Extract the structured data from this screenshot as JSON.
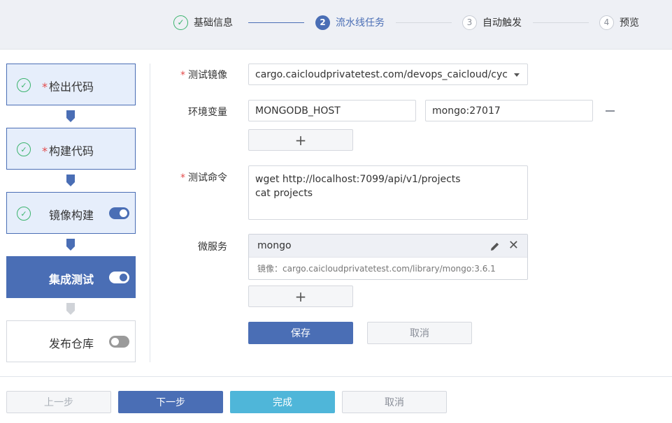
{
  "stepper": {
    "steps": [
      {
        "num": "✓",
        "label": "基础信息",
        "state": "done"
      },
      {
        "num": "2",
        "label": "流水线任务",
        "state": "active"
      },
      {
        "num": "3",
        "label": "自动触发",
        "state": "pending"
      },
      {
        "num": "4",
        "label": "预览",
        "state": "pending"
      }
    ]
  },
  "pipeline": {
    "stages": [
      {
        "label": "检出代码",
        "required": "*",
        "completed": true,
        "toggle": null
      },
      {
        "label": "构建代码",
        "required": "*",
        "completed": true,
        "toggle": null
      },
      {
        "label": "镜像构建",
        "required": "",
        "completed": true,
        "toggle": "on"
      },
      {
        "label": "集成测试",
        "required": "",
        "completed": false,
        "toggle": "on",
        "active": true
      },
      {
        "label": "发布仓库",
        "required": "",
        "completed": false,
        "toggle": "off"
      }
    ]
  },
  "form": {
    "test_image": {
      "label": "测试镜像",
      "value": "cargo.caicloudprivatetest.com/devops_caicloud/cyclone"
    },
    "env_vars": {
      "label": "环境变量",
      "rows": [
        {
          "key": "MONGODB_HOST",
          "value": "mongo:27017"
        }
      ]
    },
    "test_command": {
      "label": "测试命令",
      "value": "wget http://localhost:7099/api/v1/projects\ncat projects"
    },
    "microservices": {
      "label": "微服务",
      "items": [
        {
          "name": "mongo",
          "image_label": "镜像：",
          "image": "cargo.caicloudprivatetest.com/library/mongo:3.6.1"
        }
      ]
    },
    "add_symbol": "+",
    "save_label": "保存",
    "cancel_label": "取消"
  },
  "footer": {
    "prev_label": "上一步",
    "next_label": "下一步",
    "finish_label": "完成",
    "cancel_label": "取消"
  },
  "colors": {
    "primary": "#4a6eb5",
    "success": "#3cb46e",
    "required": "#e34b4b",
    "finish": "#4fb6d9"
  }
}
